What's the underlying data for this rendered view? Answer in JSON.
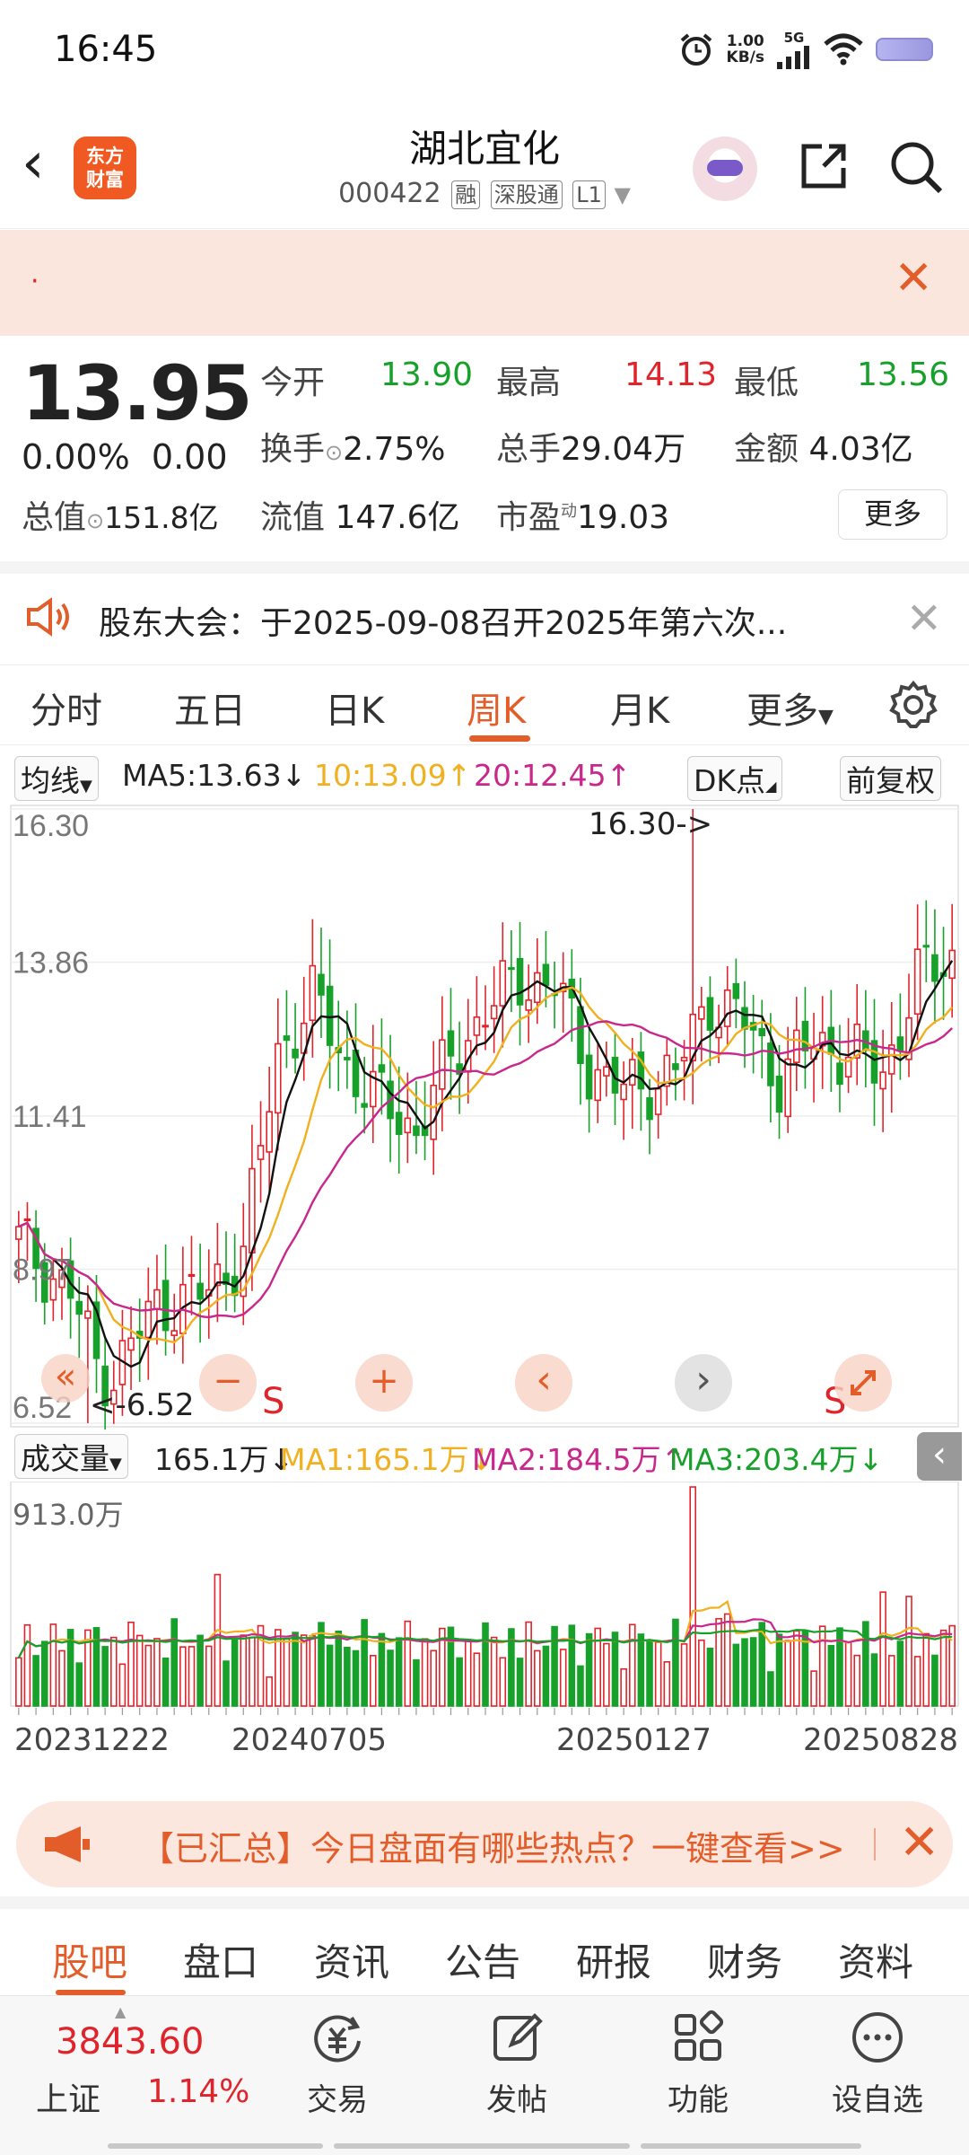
{
  "status_bar": {
    "time": "16:45",
    "net_speed_value": "1.00",
    "net_speed_unit": "KB/s",
    "network": "5G"
  },
  "header": {
    "back_icon": "chevron-left-icon",
    "logo_line1": "东方",
    "logo_line2": "财富",
    "stock_name": "湖北宜化",
    "stock_code": "000422",
    "tags": [
      "融",
      "深股通",
      "L1"
    ],
    "share_icon": "share-icon",
    "search_icon": "search-icon"
  },
  "banner": {
    "text": "·",
    "close_icon": "close-icon"
  },
  "quote": {
    "price": "13.95",
    "change_pct": "0.00%",
    "change": "0.00",
    "open_label": "今开",
    "open": "13.90",
    "high_label": "最高",
    "high": "14.13",
    "low_label": "最低",
    "low": "13.56",
    "turnover_label": "换手",
    "turnover": "2.75%",
    "volume_label": "总手",
    "volume": "29.04万",
    "amount_label": "金额",
    "amount": "4.03亿",
    "total_cap_label": "总值",
    "total_cap": "151.8亿",
    "float_cap_label": "流值",
    "float_cap": "147.6亿",
    "pe_label": "市盈",
    "pe_sup": "动",
    "pe": "19.03",
    "more_button": "更多"
  },
  "notice": {
    "text": "股东大会：于2025-09-08召开2025年第六次...",
    "close_icon": "close-icon"
  },
  "chart_tabs": {
    "items": [
      "分时",
      "五日",
      "日K",
      "周K",
      "月K",
      "更多"
    ],
    "active": "周K",
    "settings_icon": "gear-icon"
  },
  "ma_row": {
    "selector": "均线",
    "ma5": "MA5:13.63",
    "ma5_arrow": "↓",
    "ma10": "10:13.09",
    "ma10_arrow": "↑",
    "ma20": "20:12.45",
    "ma20_arrow": "↑",
    "dk_button": "DK点",
    "adjust_button": "前复权"
  },
  "kchart": {
    "y_labels": [
      "16.30",
      "13.86",
      "11.41",
      "8.97",
      "6.52"
    ],
    "high_marker": "16.30->",
    "low_marker": "<-6.52",
    "s_mark": "S",
    "controls": [
      "«",
      "−",
      "+",
      "‹",
      "›"
    ],
    "expand_icon": "expand-icon"
  },
  "vol_row": {
    "selector": "成交量",
    "vol": "165.1万",
    "vol_arrow": "↓",
    "ma1": "MA1:165.1万",
    "ma1_arrow": "↓",
    "ma2": "MA2:184.5万",
    "ma2_arrow": "↑",
    "ma3": "MA3:203.4万",
    "ma3_arrow": "↓",
    "collapse_icon": "chevron-left-icon"
  },
  "vol_chart": {
    "y_label": "913.0万"
  },
  "dates": [
    "20231222",
    "20240705",
    "20250127",
    "20250828"
  ],
  "chart_data": {
    "type": "candlestick",
    "period": "weekly",
    "y_range": [
      6.52,
      16.3
    ],
    "y_ticks": [
      16.3,
      13.86,
      11.41,
      8.97,
      6.52
    ],
    "x_ticks": [
      "20231222",
      "20240705",
      "20250127",
      "20250828"
    ],
    "max_price": 16.3,
    "min_price": 6.52,
    "series": [
      {
        "name": "MA5",
        "color": "#111111"
      },
      {
        "name": "MA10",
        "color": "#f0b020"
      },
      {
        "name": "MA20",
        "color": "#c8288c"
      }
    ],
    "volume_series": [
      {
        "name": "MA1",
        "color": "#f0b020"
      },
      {
        "name": "MA2",
        "color": "#c8288c"
      },
      {
        "name": "MA3",
        "color": "#17a12a"
      }
    ],
    "volume_max": "913.0万"
  },
  "hot_banner": {
    "text": "【已汇总】今日盘面有哪些热点？一键查看>>",
    "horn_icon": "megaphone-icon",
    "close_icon": "close-icon"
  },
  "sub_tabs": {
    "items": [
      "股吧",
      "盘口",
      "资讯",
      "公告",
      "研报",
      "财务",
      "资料"
    ],
    "active": "股吧"
  },
  "bottom_bar": {
    "index_value": "3843.60",
    "index_name": "上证",
    "index_pct": "1.14%",
    "nav": [
      {
        "label": "交易",
        "icon": "trade-icon"
      },
      {
        "label": "发帖",
        "icon": "edit-icon"
      },
      {
        "label": "功能",
        "icon": "grid-icon"
      },
      {
        "label": "设自选",
        "icon": "more-icon"
      }
    ]
  },
  "colors": {
    "up": "#e0242b",
    "down": "#17a12a",
    "accent": "#e35d2b"
  }
}
